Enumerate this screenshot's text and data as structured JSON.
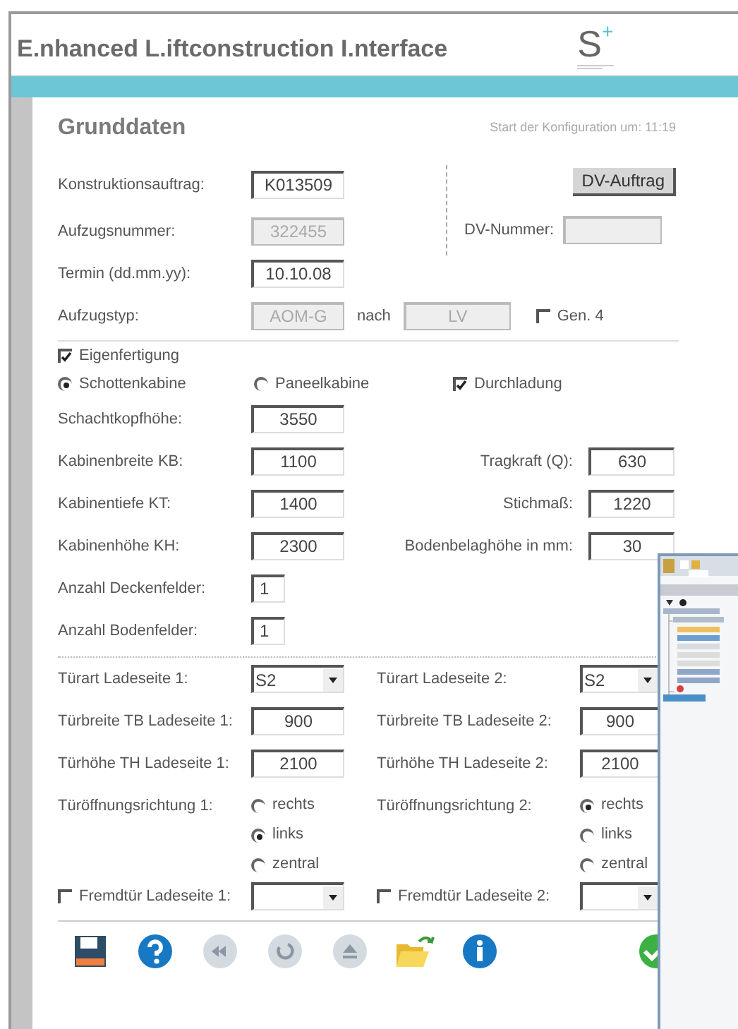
{
  "header": {
    "title": "E.nhanced L.iftconstruction I.nterface",
    "logo": {
      "letter": "S",
      "mark": "+"
    }
  },
  "section": {
    "title": "Grunddaten",
    "start_time": "Start der Konfiguration um: 11:19"
  },
  "top_fields": [
    {
      "label": "Konstruktionsauftrag:",
      "value": "K013509",
      "disabled": false
    },
    {
      "label": "Aufzugsnummer:",
      "value": "322455",
      "disabled": true
    },
    {
      "label": "Termin (dd.mm.yy):",
      "value": "10.10.08",
      "disabled": false
    }
  ],
  "dv": {
    "button": "DV-Auftrag",
    "label": "DV-Nummer:",
    "disabled": true
  },
  "type_row": {
    "label": "Aufzugstyp:",
    "value": "AOM-G",
    "disabled": true,
    "connector": "nach",
    "target": "LV",
    "target_disabled": true,
    "gen4": {
      "label": "Gen. 4",
      "checked": false
    }
  },
  "eigenfertigung": {
    "label": "Eigenfertigung",
    "checked": true
  },
  "cabin_types": [
    {
      "label": "Schottenkabine",
      "selected": true
    },
    {
      "label": "Paneelkabine",
      "selected": false
    }
  ],
  "durchladung": {
    "label": "Durchladung",
    "checked": true
  },
  "dimension_rows": [
    {
      "left": {
        "label": "Schachtkopfhöhe:",
        "value": "3550"
      }
    },
    {
      "left": {
        "label": "Kabinenbreite KB:",
        "value": "1100"
      },
      "right": {
        "label": "Tragkraft (Q):",
        "value": "630"
      }
    },
    {
      "left": {
        "label": "Kabinentiefe KT:",
        "value": "1400"
      },
      "right": {
        "label": "Stichmaß:",
        "value": "1220"
      }
    },
    {
      "left": {
        "label": "Kabinenhöhe KH:",
        "value": "2300"
      },
      "right": {
        "label": "Bodenbelaghöhe in mm:",
        "value": "30"
      }
    }
  ],
  "counts": [
    {
      "label": "Anzahl Deckenfelder:",
      "value": "1"
    },
    {
      "label": "Anzahl Bodenfelder:",
      "value": "1"
    }
  ],
  "doors": [
    {
      "type_label": "Türart Ladeseite 1:",
      "type_value": "S2",
      "width_label": "Türbreite TB Ladeseite 1:",
      "width_value": "900",
      "height_label": "Türhöhe TH Ladeseite 1:",
      "height_value": "2100",
      "direction_label": "Türöffnungsrichtung 1:",
      "directions": [
        {
          "label": "rechts",
          "selected": false
        },
        {
          "label": "links",
          "selected": true
        },
        {
          "label": "zentral",
          "selected": false
        }
      ],
      "foreign": {
        "label": "Fremdtür Ladeseite 1:",
        "checked": false
      }
    },
    {
      "type_label": "Türart Ladeseite 2:",
      "type_value": "S2",
      "width_label": "Türbreite TB Ladeseite 2:",
      "width_value": "900",
      "height_label": "Türhöhe TH Ladeseite 2:",
      "height_value": "2100",
      "direction_label": "Türöffnungsrichtung 2:",
      "directions": [
        {
          "label": "rechts",
          "selected": true
        },
        {
          "label": "links",
          "selected": false
        },
        {
          "label": "zentral",
          "selected": false
        }
      ],
      "foreign": {
        "label": "Fremdtür Ladeseite 2:",
        "checked": false
      }
    }
  ],
  "toolbar": [
    {
      "kind": "save",
      "disabled": false
    },
    {
      "kind": "help",
      "disabled": false
    },
    {
      "kind": "rewind",
      "disabled": true
    },
    {
      "kind": "undo",
      "disabled": true
    },
    {
      "kind": "eject",
      "disabled": true
    },
    {
      "kind": "open",
      "disabled": false
    },
    {
      "kind": "info",
      "disabled": false
    },
    {
      "kind": "confirm",
      "disabled": false
    }
  ]
}
